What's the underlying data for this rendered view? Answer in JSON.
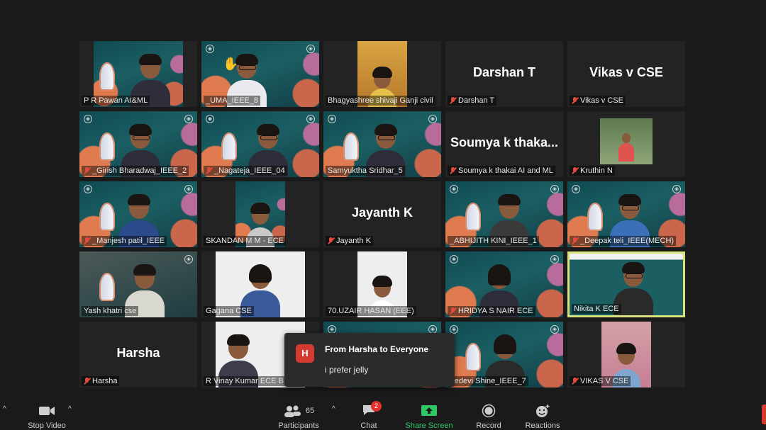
{
  "participants_grid": [
    {
      "name": "P R Pawan AI&ML",
      "muted": false,
      "video": "cam",
      "big_name": ""
    },
    {
      "name": "_UMA_IEEE_8",
      "muted": false,
      "video": "cam",
      "big_name": ""
    },
    {
      "name": "Bhagyashree shivaji Ganji civil",
      "muted": false,
      "video": "cam",
      "big_name": ""
    },
    {
      "name": "Darshan T",
      "muted": true,
      "video": "off",
      "big_name": "Darshan T"
    },
    {
      "name": "Vikas v CSE",
      "muted": true,
      "video": "off",
      "big_name": "Vikas v CSE"
    },
    {
      "name": "_Girish Bharadwaj_IEEE_2",
      "muted": true,
      "video": "cam",
      "big_name": ""
    },
    {
      "name": "_Nagateja_IEEE_04",
      "muted": true,
      "video": "cam",
      "big_name": ""
    },
    {
      "name": "Samyuktha Sridhar_5",
      "muted": false,
      "video": "cam",
      "big_name": ""
    },
    {
      "name": "Soumya k thakai AI and ML",
      "muted": true,
      "video": "off",
      "big_name": "Soumya k thaka..."
    },
    {
      "name": "Kruthin N",
      "muted": true,
      "video": "cam",
      "big_name": ""
    },
    {
      "name": "_Manjesh patil_IEEE",
      "muted": true,
      "video": "cam",
      "big_name": ""
    },
    {
      "name": "SKANDAN M M - ECE",
      "muted": false,
      "video": "cam",
      "big_name": ""
    },
    {
      "name": "Jayanth K",
      "muted": true,
      "video": "off",
      "big_name": "Jayanth K"
    },
    {
      "name": "_ABHIJITH KINI_IEEE_1",
      "muted": false,
      "video": "cam",
      "big_name": ""
    },
    {
      "name": "_Deepak teli_IEEE(MECH)",
      "muted": true,
      "video": "cam",
      "big_name": ""
    },
    {
      "name": "Yash khatri cse",
      "muted": false,
      "video": "cam",
      "big_name": ""
    },
    {
      "name": "Gagana CSE",
      "muted": false,
      "video": "cam",
      "big_name": ""
    },
    {
      "name": "70.UZAIR HASAN (EEE)",
      "muted": false,
      "video": "cam",
      "big_name": ""
    },
    {
      "name": "HRIDYA S NAIR ECE",
      "muted": true,
      "video": "cam",
      "big_name": ""
    },
    {
      "name": "Nikita K ECE",
      "muted": false,
      "video": "cam",
      "big_name": ""
    },
    {
      "name": "Harsha",
      "muted": true,
      "video": "off",
      "big_name": "Harsha"
    },
    {
      "name": "R Vinay Kumar ECE B",
      "muted": false,
      "video": "cam",
      "big_name": ""
    },
    {
      "name": "",
      "muted": false,
      "video": "cam",
      "big_name": ""
    },
    {
      "name": "reedevi Shine_IEEE_7",
      "muted": false,
      "video": "cam",
      "big_name": ""
    },
    {
      "name": "VIKAS V CSE",
      "muted": true,
      "video": "cam",
      "big_name": ""
    }
  ],
  "chat_notification": {
    "avatar_letter": "H",
    "from": "From Harsha to Everyone",
    "message": "i prefer jelly"
  },
  "toolbar": {
    "stop_video": "Stop Video",
    "participants": "Participants",
    "participants_count": "65",
    "chat": "Chat",
    "chat_badge": "2",
    "share_screen": "Share Screen",
    "record": "Record",
    "reactions": "Reactions"
  },
  "colors": {
    "active_speaker_border": "#d8e27a",
    "share_green": "#2ec966",
    "muted_red": "#e34b3f"
  }
}
